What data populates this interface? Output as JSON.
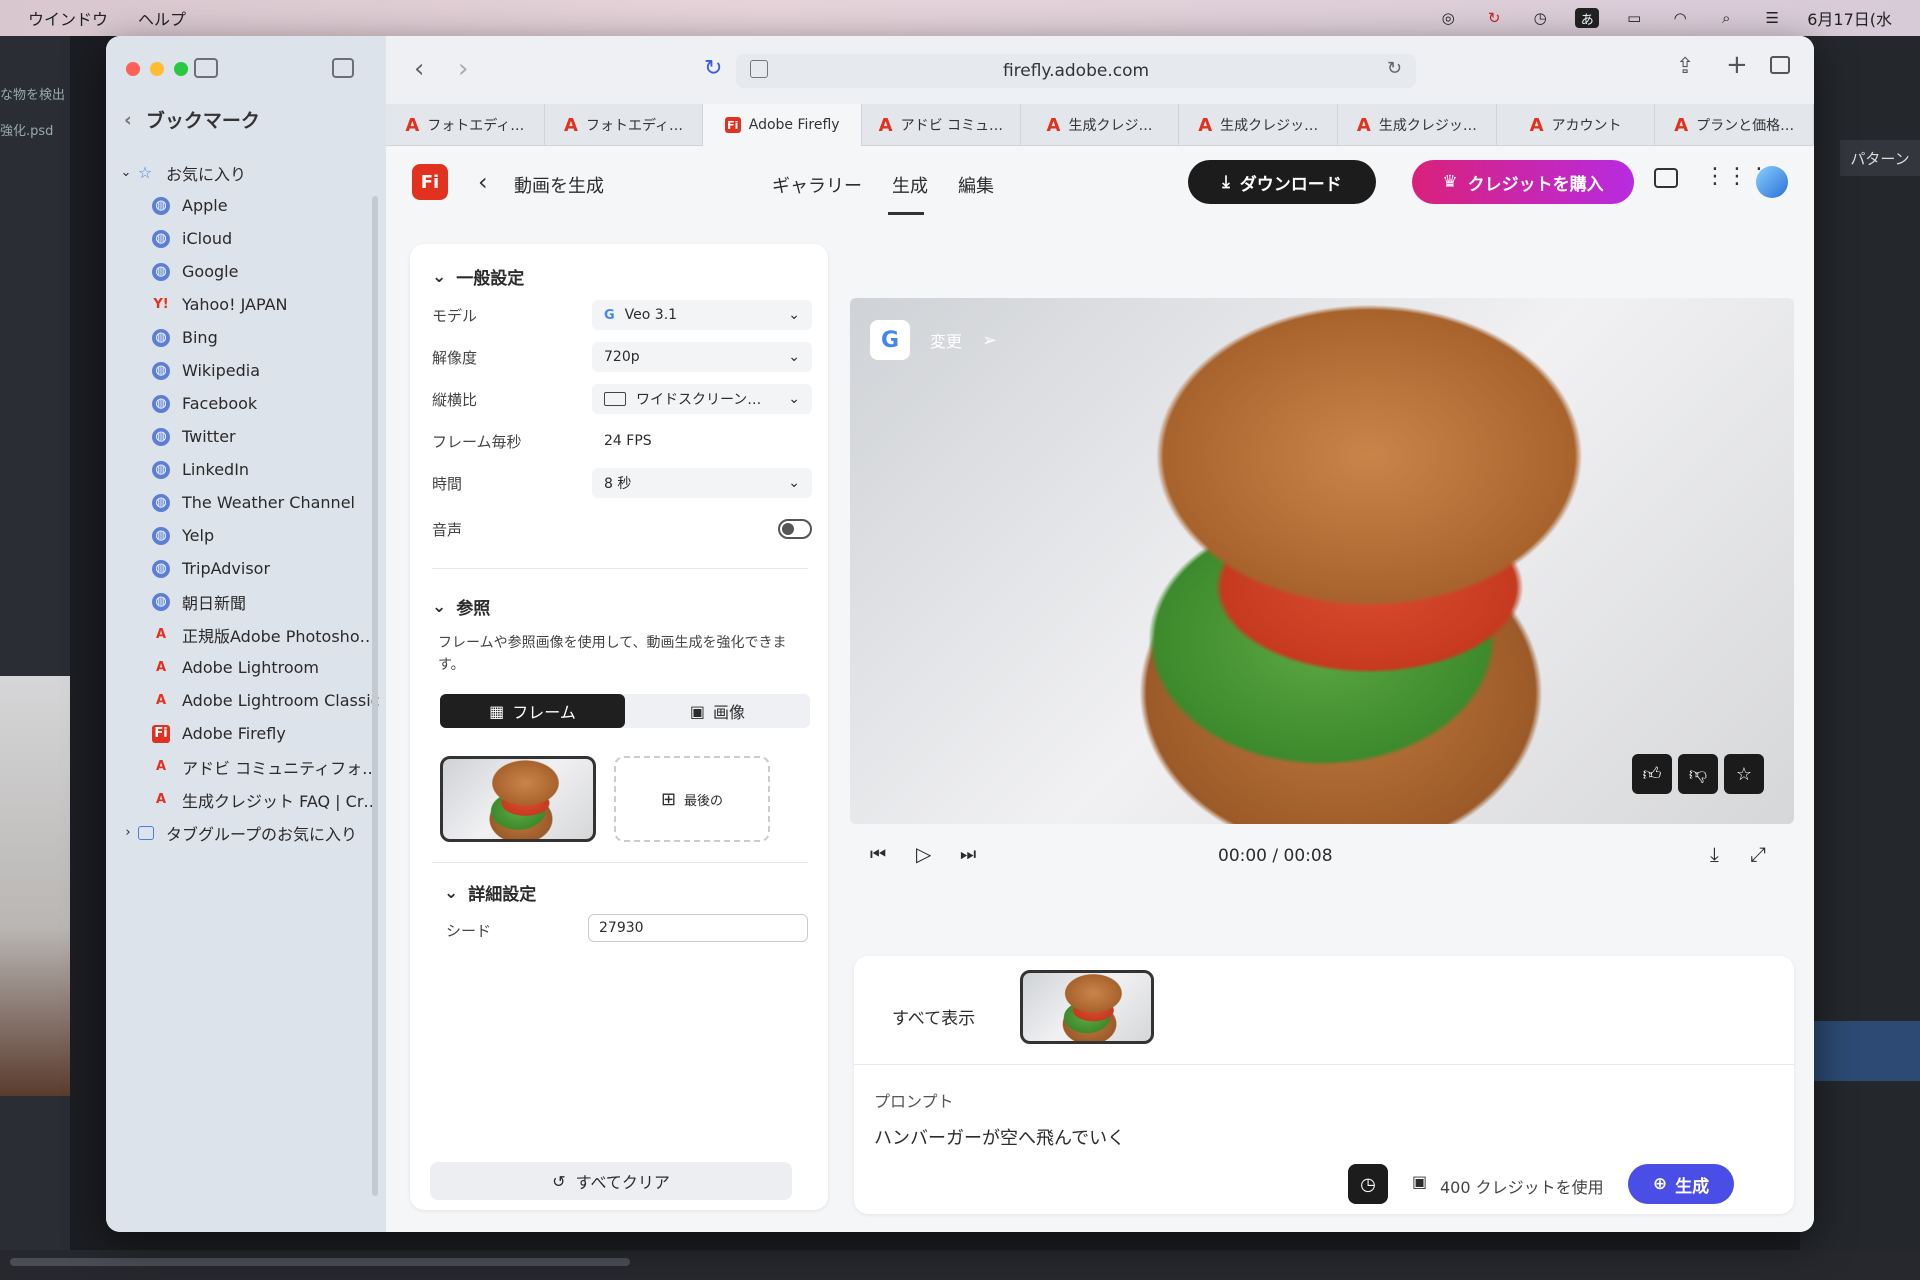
{
  "menubar": {
    "items": [
      "ウインドウ",
      "ヘルプ"
    ],
    "ime": "あ",
    "date": "6月17日(水"
  },
  "behind": {
    "left_texts": [
      "な物を検出",
      "強化.psd"
    ],
    "right_panel_label": "パターン"
  },
  "browser": {
    "url": "firefly.adobe.com",
    "tabs": [
      {
        "label": "フォトエディ…",
        "icon": "adobe-icon"
      },
      {
        "label": "フォトエディ…",
        "icon": "adobe-icon"
      },
      {
        "label": "Adobe Firefly",
        "icon": "firefly-icon",
        "active": true
      },
      {
        "label": "アドビ コミュ…",
        "icon": "adobe-icon"
      },
      {
        "label": "生成クレジ…",
        "icon": "adobe-icon"
      },
      {
        "label": "生成クレジッ…",
        "icon": "adobe-icon"
      },
      {
        "label": "生成クレジッ…",
        "icon": "adobe-icon"
      },
      {
        "label": "アカウント",
        "icon": "adobe-icon"
      },
      {
        "label": "プランと価格…",
        "icon": "adobe-icon"
      }
    ]
  },
  "sidebar": {
    "title": "ブックマーク",
    "favorites_label": "お気に入り",
    "items": [
      {
        "label": "Apple",
        "icon": "globe"
      },
      {
        "label": "iCloud",
        "icon": "globe"
      },
      {
        "label": "Google",
        "icon": "globe"
      },
      {
        "label": "Yahoo! JAPAN",
        "icon": "yahoo"
      },
      {
        "label": "Bing",
        "icon": "globe"
      },
      {
        "label": "Wikipedia",
        "icon": "globe"
      },
      {
        "label": "Facebook",
        "icon": "globe"
      },
      {
        "label": "Twitter",
        "icon": "globe"
      },
      {
        "label": "LinkedIn",
        "icon": "globe"
      },
      {
        "label": "The Weather Channel",
        "icon": "globe"
      },
      {
        "label": "Yelp",
        "icon": "globe"
      },
      {
        "label": "TripAdvisor",
        "icon": "globe"
      },
      {
        "label": "朝日新聞",
        "icon": "globe"
      },
      {
        "label": "正規版Adobe Photosho…",
        "icon": "adobe"
      },
      {
        "label": "Adobe Lightroom",
        "icon": "adobe"
      },
      {
        "label": "Adobe Lightroom Classic",
        "icon": "adobe"
      },
      {
        "label": "Adobe Firefly",
        "icon": "firefly"
      },
      {
        "label": "アドビ コミュニティフォ…",
        "icon": "adobe"
      },
      {
        "label": "生成クレジット FAQ | Cr…",
        "icon": "adobe"
      }
    ],
    "tabgroup_label": "タブグループのお気に入り"
  },
  "app": {
    "logo": "Fi",
    "back_title": "動画を生成",
    "nav": [
      "ギャラリー",
      "生成",
      "編集"
    ],
    "download_label": "ダウンロード",
    "buy_credits_label": "クレジットを購入"
  },
  "settings": {
    "general_title": "一般設定",
    "model_label": "モデル",
    "model_value": "Veo 3.1",
    "resolution_label": "解像度",
    "resolution_value": "720p",
    "aspect_label": "縦横比",
    "aspect_value": "ワイドスクリーン…",
    "fps_label": "フレーム毎秒",
    "fps_value": "24 FPS",
    "duration_label": "時間",
    "duration_value": "8 秒",
    "audio_label": "音声",
    "reference_title": "参照",
    "reference_desc": "フレームや参照画像を使用して、動画生成を強化できます。",
    "seg_frame": "フレーム",
    "seg_image": "画像",
    "last_frame_label": "最後の",
    "advanced_title": "詳細設定",
    "seed_label": "シード",
    "seed_value": "27930",
    "clear_all": "すべてクリア"
  },
  "video": {
    "change_label": "変更",
    "time": "00:00 / 00:08"
  },
  "bottom": {
    "show_all": "すべて表示",
    "prompt_label": "プロンプト",
    "prompt_text": "ハンバーガーが空へ飛んでいく",
    "credits_text": "400 クレジットを使用",
    "generate_label": "生成"
  }
}
